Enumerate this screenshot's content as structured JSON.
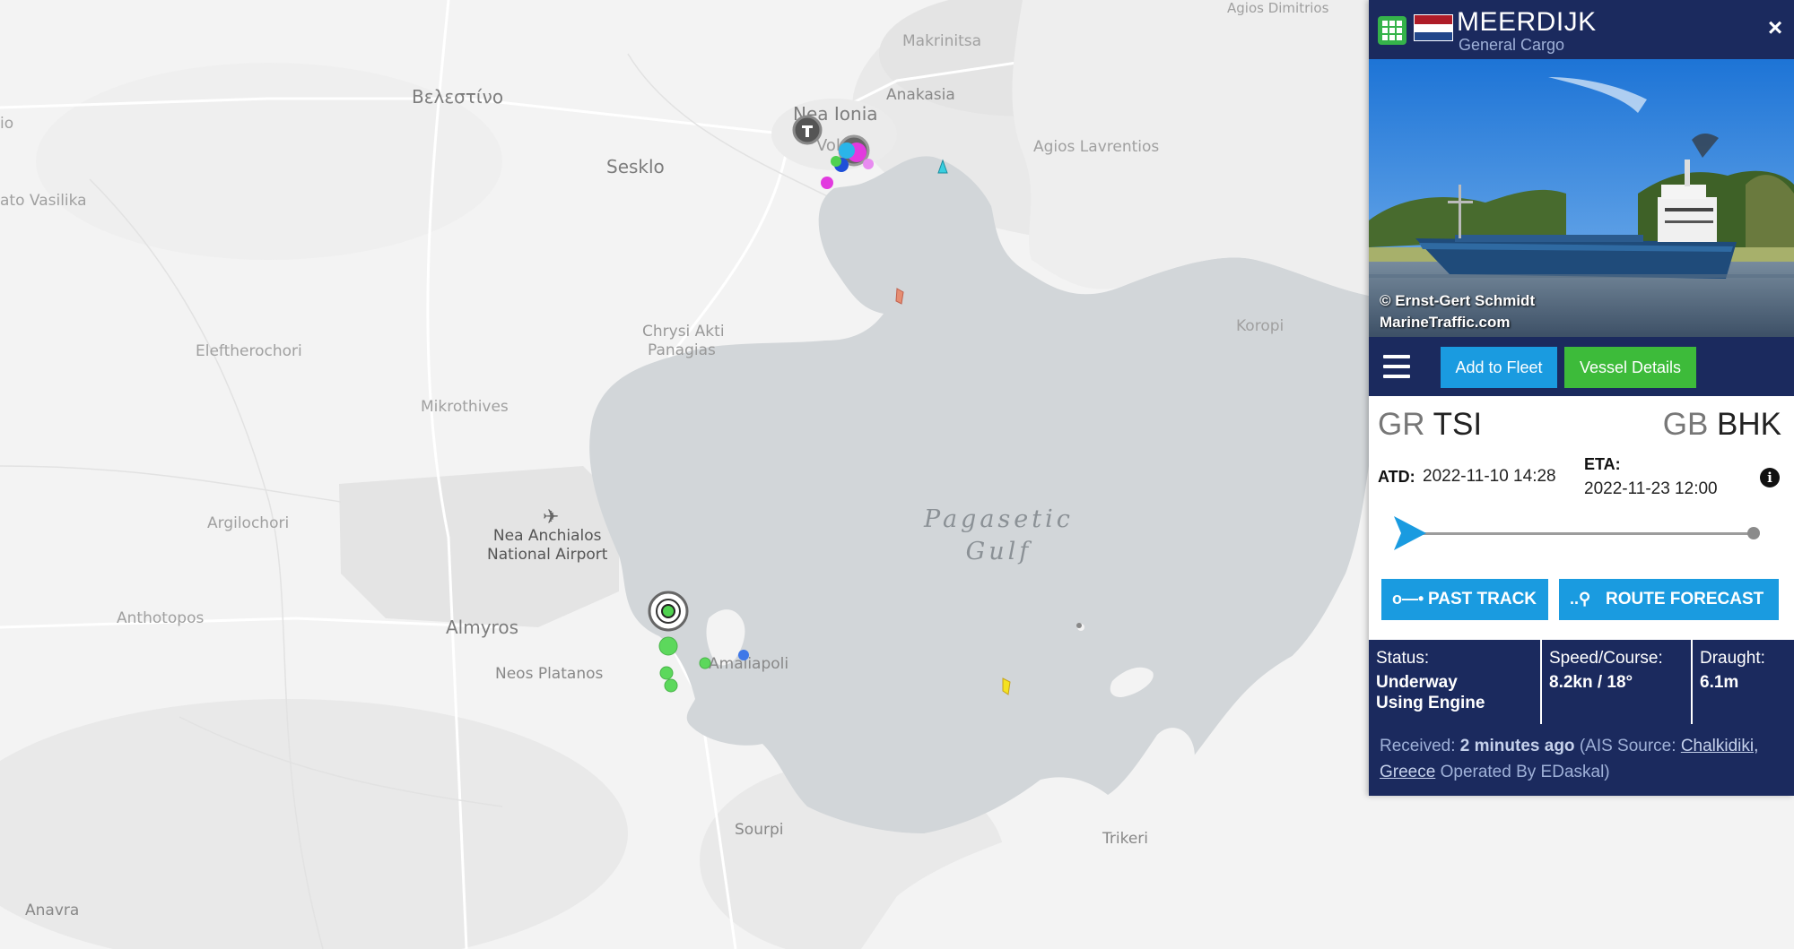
{
  "map": {
    "places": {
      "velestino": "Βελεστίνο",
      "makrinitsa": "Makrinitsa",
      "agios_dimitrios": "Agios Dimitrios",
      "anakasia": "Anakasia",
      "nea_ionia": "Nea Ionia",
      "volos": "Volos",
      "sesklo": "Sesklo",
      "agios_lavrentios": "Agios Lavrentios",
      "kato_vasilika": "ato Vasilika",
      "io": "io",
      "eleftherochori": "Eleftherochori",
      "chrysi_akti": "Chrysi Akti",
      "panagias": "Panagias",
      "koropi": "Koropi",
      "mikrothives": "Mikrothives",
      "argilochori": "Argilochori",
      "airport_line1": "Nea Anchialos",
      "airport_line2": "National Airport",
      "anthotopos": "Anthotopos",
      "almyros": "Almyros",
      "neos_platanos": "Neos Platanos",
      "amaliapoli": "Amaliapoli",
      "sourpi": "Sourpi",
      "trikeri": "Trikeri",
      "anavra": "Anavra",
      "sea_line1": "Pagasetic",
      "sea_line2": "Gulf"
    }
  },
  "panel": {
    "vessel_name": "MEERDIJK",
    "vessel_type": "General Cargo",
    "flag": "Netherlands",
    "close_glyph": "×",
    "photo_credit_line1": "© Ernst-Gert Schmidt",
    "photo_credit_line2": "MarineTraffic.com",
    "add_to_fleet": "Add to Fleet",
    "vessel_details": "Vessel Details",
    "origin_cc": "GR",
    "origin_port": "TSI",
    "dest_cc": "GB",
    "dest_port": "BHK",
    "atd_label": "ATD:",
    "atd_value": "2022-11-10 14:28",
    "eta_label": "ETA:",
    "eta_value": "2022-11-23 12:00",
    "info_glyph": "i",
    "past_track": "PAST TRACK",
    "route_forecast": "ROUTE FORECAST",
    "status_label": "Status:",
    "status_value_line1": "Underway",
    "status_value_line2": "Using Engine",
    "speed_label": "Speed/Course:",
    "speed_value": "8.2kn / 18°",
    "draught_label": "Draught:",
    "draught_value": "6.1m",
    "received_prefix": "Received:",
    "received_time": "2 minutes ago",
    "received_source_open": "(AIS Source:",
    "received_source_link": "Chalkidiki, Greece",
    "received_operated": "Operated By EDaskal)"
  },
  "colors": {
    "header_navy": "#1b2a5e",
    "accent_blue": "#1a9be0",
    "accent_green": "#3dbb3a",
    "sea": "#d2d6d9",
    "land": "#f3f3f3"
  },
  "icons": [
    "grid-icon",
    "netherlands-flag",
    "close-icon",
    "menu-icon",
    "ship-icon",
    "info-icon",
    "past-track-icon",
    "route-forecast-icon",
    "airport-icon",
    "port-icon"
  ]
}
